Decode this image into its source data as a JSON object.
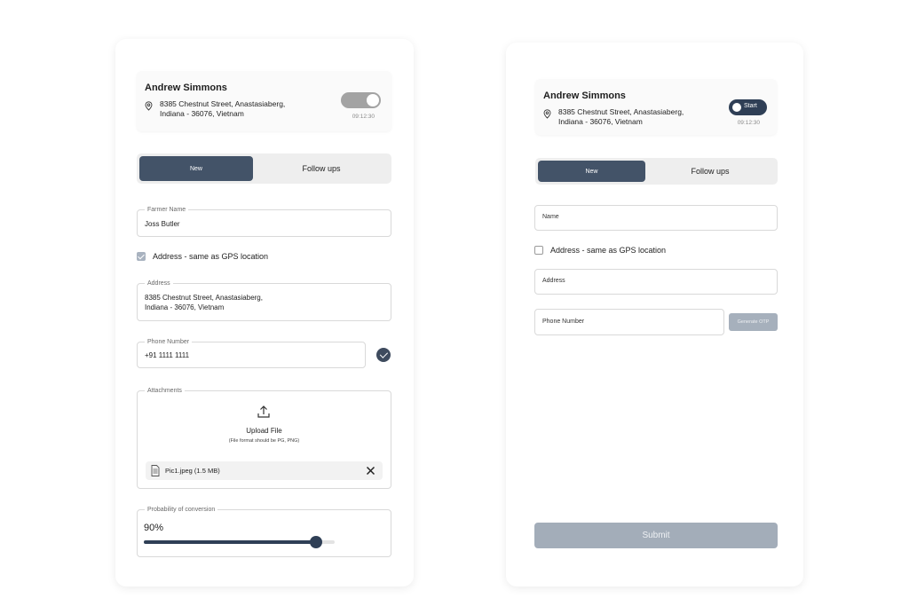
{
  "left": {
    "profile": {
      "name": "Andrew Simmons",
      "address_line1": "8385 Chestnut Street, Anastasiaberg,",
      "address_line2": "Indiana - 36076, Vietnam",
      "time": "09:12:30",
      "toggle_on": false
    },
    "tabs": [
      {
        "label": "New"
      },
      {
        "label": "Follow ups"
      }
    ],
    "farmer_name": {
      "label": "Farmer Name",
      "value": "Joss Butler"
    },
    "same_as_gps": {
      "label": "Address - same as GPS location",
      "checked": true
    },
    "address": {
      "label": "Address",
      "line1": "8385 Chestnut Street, Anastasiaberg,",
      "line2": "Indiana - 36076, Vietnam"
    },
    "phone": {
      "label": "Phone Number",
      "value": "+91 1111 1111",
      "verified": true
    },
    "attachments": {
      "label": "Attachments",
      "upload_title": "Upload File",
      "upload_hint": "(File format should be PG, PNG)",
      "file_name": "Pic1.jpeg (1.5 MB)"
    },
    "probability": {
      "label": "Probability of conversion",
      "value_text": "90%",
      "value": 0.9
    }
  },
  "right": {
    "profile": {
      "name": "Andrew Simmons",
      "address_line1": "8385 Chestnut Street, Anastasiaberg,",
      "address_line2": "Indiana - 36076, Vietnam",
      "time": "09:12:30",
      "toggle_label": "Start"
    },
    "tabs": [
      {
        "label": "New"
      },
      {
        "label": "Follow ups"
      }
    ],
    "name_field": {
      "placeholder": "Name"
    },
    "same_as_gps": {
      "label": "Address - same as GPS location",
      "checked": false
    },
    "address_field": {
      "placeholder": "Address"
    },
    "phone_field": {
      "placeholder": "Phone Number"
    },
    "otp_button": "Generate OTP",
    "submit_button": "Submit"
  },
  "colors": {
    "primary": "#435368",
    "dark": "#2f3f56",
    "disabled": "#a3adb9",
    "toggle_off": "#a3a3a3"
  }
}
